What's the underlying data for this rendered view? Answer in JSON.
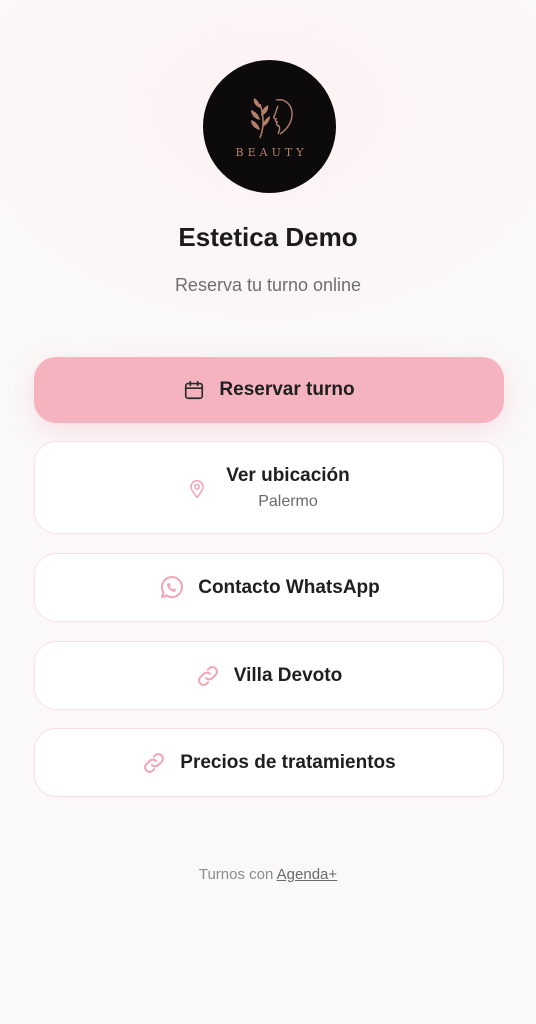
{
  "profile": {
    "logo_text": "BEAUTY",
    "name": "Estetica Demo",
    "tagline": "Reserva tu turno online"
  },
  "buttons": {
    "book": {
      "label": "Reservar turno",
      "icon": "calendar-icon"
    },
    "location": {
      "label": "Ver ubicación",
      "sublabel": "Palermo",
      "icon": "map-pin-icon"
    },
    "whatsapp": {
      "label": "Contacto WhatsApp",
      "icon": "whatsapp-icon"
    },
    "link1": {
      "label": "Villa Devoto",
      "icon": "link-icon"
    },
    "link2": {
      "label": "Precios de tratamientos",
      "icon": "link-icon"
    }
  },
  "footer": {
    "prefix": "Turnos con",
    "link": "Agenda+"
  },
  "colors": {
    "primary": "#f5b3c0",
    "accent_icon": "#f0a5b4",
    "logo_gold": "#b4806a"
  }
}
